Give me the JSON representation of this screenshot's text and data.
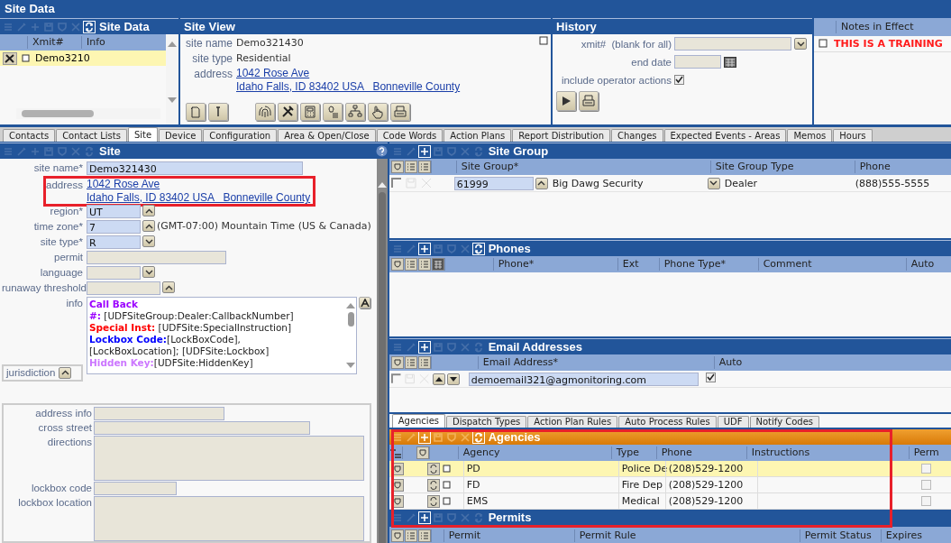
{
  "app_title": "Site Data",
  "site_data_panel": {
    "title": "Site Data",
    "toolbar": {
      "add": false,
      "refresh": true
    },
    "columns": [
      "Xmit#",
      "Info"
    ],
    "rows": [
      {
        "xmit": "Demo3210",
        "selected": true
      }
    ]
  },
  "site_view": {
    "title": "Site View",
    "site_name_label": "site name",
    "site_name": "Demo321430",
    "site_type_label": "site type",
    "site_type": "Residential",
    "address_label": "address",
    "address_lines": [
      "1042 Rose Ave",
      "Idaho Falls, ID 83402 USA   Bonneville County"
    ]
  },
  "history": {
    "title": "History",
    "xmit_label": "xmit#  (blank for all)",
    "end_date_label": "end date",
    "include_label": "include operator actions",
    "include_checked": true
  },
  "notes": {
    "column": "Notes in Effect",
    "rows": [
      {
        "text": "THIS IS A TRAINING"
      }
    ]
  },
  "tabs": [
    {
      "label": "Contacts",
      "selected": false
    },
    {
      "label": "Contact Lists",
      "selected": false
    },
    {
      "label": "Site",
      "selected": true
    },
    {
      "label": "Device",
      "selected": false
    },
    {
      "label": "Configuration",
      "selected": false
    },
    {
      "label": "Area & Open/Close",
      "selected": false
    },
    {
      "label": "Code Words",
      "selected": false
    },
    {
      "label": "Action Plans",
      "selected": false
    },
    {
      "label": "Report Distribution",
      "selected": false
    },
    {
      "label": "Changes",
      "selected": false
    },
    {
      "label": "Expected Events - Areas",
      "selected": false
    },
    {
      "label": "Memos",
      "selected": false
    },
    {
      "label": "Hours",
      "selected": false
    }
  ],
  "site_form": {
    "title": "Site",
    "toolbar": {
      "add": false,
      "refresh": false
    },
    "fields": [
      {
        "kind": "text",
        "label": "site name*",
        "value": "Demo321430",
        "required": true
      },
      {
        "kind": "address",
        "label": "address",
        "lines": [
          "1042 Rose Ave",
          "Idaho Falls, ID 83402 USA   Bonneville County"
        ],
        "highlighted": true
      },
      {
        "kind": "lookup",
        "label": "region*",
        "value": "UT",
        "required": true
      },
      {
        "kind": "lookup",
        "label": "time zone*",
        "value": "7",
        "description": "(GMT-07:00) Mountain Time (US & Canada)",
        "required": true
      },
      {
        "kind": "select",
        "label": "site type*",
        "value": "R",
        "required": true
      },
      {
        "kind": "text",
        "label": "permit",
        "required": false
      },
      {
        "kind": "select",
        "label": "language",
        "required": false
      },
      {
        "kind": "lookup",
        "label": "runaway threshold",
        "required": false
      },
      {
        "kind": "info",
        "label": "info",
        "lines": [
          {
            "label": "Call Back",
            "color": "#9b00ff"
          },
          {
            "label": "#:",
            "text": " [UDFSiteGroup:Dealer:CallbackNumber]",
            "color": "#9b00ff"
          },
          {
            "label": "Special Inst:",
            "text": " [UDFSite:SpecialInstruction]",
            "color": "#ff0000"
          },
          {
            "label": "Lockbox Code:",
            "text": "[LockBoxCode],",
            "color": "#0000ff"
          },
          {
            "text": "[LockBoxLocation]; [UDFSite:Lockbox]"
          },
          {
            "label": "Hidden Key:",
            "text": "[UDFSite:HiddenKey]",
            "color": "#cc77ff"
          }
        ]
      }
    ],
    "jurisdiction_label": "jurisdiction",
    "location_fields": [
      {
        "label": "address info",
        "kind": "line"
      },
      {
        "label": "cross street",
        "kind": "line"
      },
      {
        "label": "directions",
        "kind": "area"
      },
      {
        "label": "lockbox code",
        "kind": "line"
      },
      {
        "label": "lockbox location",
        "kind": "area"
      }
    ]
  },
  "site_group": {
    "title": "Site Group",
    "toolbar": {
      "add": true,
      "refresh": false
    },
    "columns": [
      "Site Group*",
      "Site Group Type",
      "Phone"
    ],
    "rows": [
      {
        "code": "61999",
        "name": "Big Dawg Security",
        "type": "Dealer",
        "phone": "(888)555-5555"
      }
    ]
  },
  "phones": {
    "title": "Phones",
    "toolbar": {
      "add": true,
      "refresh": true
    },
    "columns": [
      "Phone*",
      "Ext",
      "Phone Type*",
      "Comment",
      "Auto"
    ]
  },
  "emails": {
    "title": "Email Addresses",
    "toolbar": {
      "add": true,
      "refresh": false
    },
    "columns": [
      "Email Address*",
      "Auto"
    ],
    "rows": [
      {
        "address": "demoemail321@agmonitoring.com",
        "auto": true
      }
    ]
  },
  "subtabs": [
    {
      "label": "Agencies",
      "selected": true
    },
    {
      "label": "Dispatch Types",
      "selected": false
    },
    {
      "label": "Action Plan Rules",
      "selected": false
    },
    {
      "label": "Auto Process Rules",
      "selected": false
    },
    {
      "label": "UDF",
      "selected": false
    },
    {
      "label": "Notify Codes",
      "selected": false
    }
  ],
  "agencies": {
    "title": "Agencies",
    "highlighted": true,
    "toolbar": {
      "add": true,
      "refresh": true
    },
    "columns": [
      "Agency",
      "Type",
      "Phone",
      "Instructions",
      "Perm"
    ],
    "rows": [
      {
        "agency": "PD",
        "type": "Police De",
        "phone": "(208)529-1200",
        "perm": false,
        "selected": true
      },
      {
        "agency": "FD",
        "type": "Fire Dep",
        "phone": "(208)529-1200",
        "perm": false,
        "selected": false
      },
      {
        "agency": "EMS",
        "type": "Medical",
        "phone": "(208)529-1200",
        "perm": false,
        "selected": false
      }
    ]
  },
  "permits": {
    "title": "Permits",
    "toolbar": {
      "add": true,
      "refresh": false
    },
    "columns": [
      "Permit",
      "Permit Rule",
      "Permit Status",
      "Expires"
    ]
  }
}
